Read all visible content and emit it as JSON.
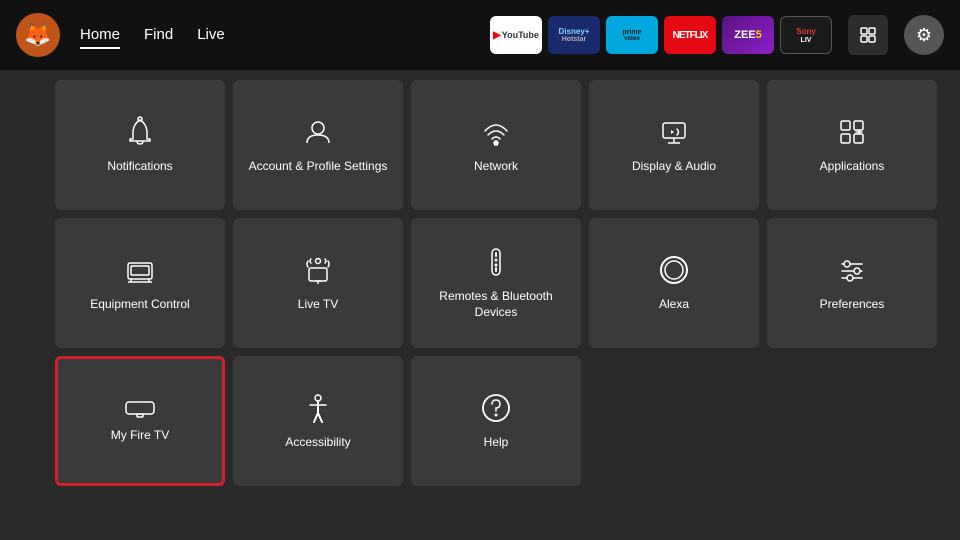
{
  "header": {
    "logo_emoji": "🦊",
    "nav": [
      {
        "label": "Home",
        "active": true
      },
      {
        "label": "Find",
        "active": false
      },
      {
        "label": "Live",
        "active": false
      }
    ],
    "apps": [
      {
        "id": "youtube",
        "label": "▶ YouTube",
        "class": "youtube"
      },
      {
        "id": "disney",
        "label": "Disney+ Hotstar",
        "class": "disney"
      },
      {
        "id": "prime",
        "label": "prime video",
        "class": "prime"
      },
      {
        "id": "netflix",
        "label": "NETFLIX",
        "class": "netflix"
      },
      {
        "id": "zee5",
        "label": "ZEE5",
        "class": "zee5"
      },
      {
        "id": "sony",
        "label": "Sony LIV",
        "class": "sony"
      }
    ],
    "grid_btn_label": "⊞",
    "settings_btn_label": "⚙"
  },
  "grid": {
    "rows": [
      [
        {
          "id": "notifications",
          "label": "Notifications",
          "selected": false
        },
        {
          "id": "account-profile",
          "label": "Account & Profile Settings",
          "selected": false
        },
        {
          "id": "network",
          "label": "Network",
          "selected": false
        },
        {
          "id": "display-audio",
          "label": "Display & Audio",
          "selected": false
        },
        {
          "id": "applications",
          "label": "Applications",
          "selected": false
        }
      ],
      [
        {
          "id": "equipment-control",
          "label": "Equipment Control",
          "selected": false
        },
        {
          "id": "live-tv",
          "label": "Live TV",
          "selected": false
        },
        {
          "id": "remotes-bluetooth",
          "label": "Remotes & Bluetooth Devices",
          "selected": false
        },
        {
          "id": "alexa",
          "label": "Alexa",
          "selected": false
        },
        {
          "id": "preferences",
          "label": "Preferences",
          "selected": false
        }
      ],
      [
        {
          "id": "my-fire-tv",
          "label": "My Fire TV",
          "selected": true
        },
        {
          "id": "accessibility",
          "label": "Accessibility",
          "selected": false
        },
        {
          "id": "help",
          "label": "Help",
          "selected": false
        },
        {
          "id": "empty1",
          "label": "",
          "selected": false,
          "empty": true
        },
        {
          "id": "empty2",
          "label": "",
          "selected": false,
          "empty": true
        }
      ]
    ]
  }
}
